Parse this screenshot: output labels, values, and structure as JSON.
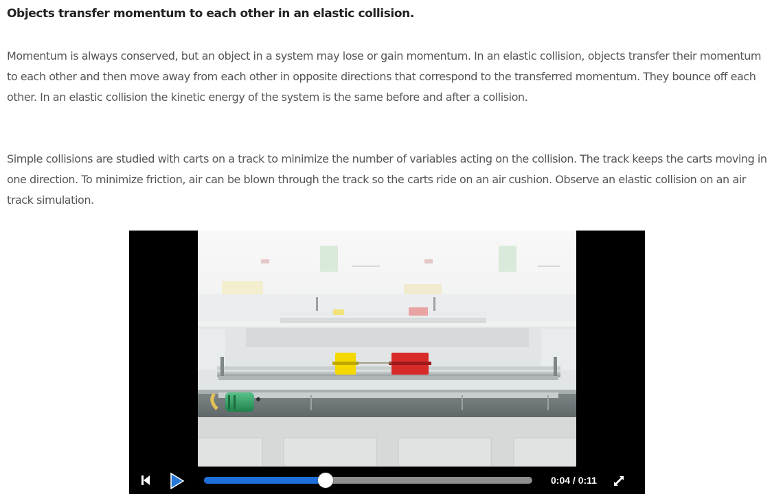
{
  "content": {
    "heading": "Objects transfer momentum to each other in an elastic collision.",
    "paragraph1": "Momentum is always conserved, but an object in a system may lose or gain momentum. In an elastic collision, objects transfer their momentum to each other and then move away from each other in opposite directions that correspond to the transferred momentum. They bounce off each other. In an elastic collision the kinetic energy of the system is the same before and after a collision.",
    "paragraph2": "Simple collisions are studied with carts on a track to minimize the number of variables acting on the collision. The track keeps the carts moving in one direction. To minimize friction, air can be blown through the track so the carts ride on an air cushion. Observe an elastic collision on an air track simulation."
  },
  "player": {
    "time": "0:04 / 0:11",
    "progress": 0.37,
    "controls": {
      "skip_icon": "skip-back-icon",
      "play_icon": "play-icon",
      "fullscreen_icon": "fullscreen-icon"
    },
    "colors": {
      "progress": "#1e6fd9",
      "play": "#2a78d6",
      "cart_yellow": "#f5d800",
      "cart_red": "#d92a2a",
      "air_blower": "#2e9a60"
    }
  }
}
